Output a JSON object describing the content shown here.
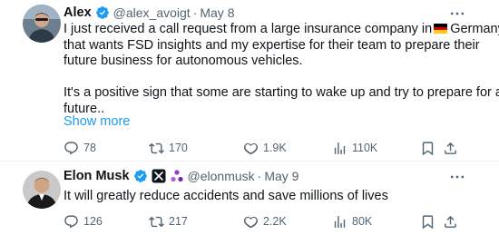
{
  "tweets": [
    {
      "name": "Alex",
      "handle": "@alex_avoigt",
      "separator": "·",
      "date": "May 8",
      "text_line1_before_flag": "I just received a call request from a large insurance company in",
      "text_line1_after_flag": "Germany",
      "text_line2": "that wants FSD insights and my expertise for their team to prepare their",
      "text_line3": "future business for autonomous vehicles.",
      "text_line4": "It's a positive sign that some are starting to wake up and try to prepare for a",
      "text_line5": "future..",
      "show_more": "Show more",
      "metrics": {
        "replies": "78",
        "reposts": "170",
        "likes": "1.9K",
        "views": "110K"
      }
    },
    {
      "name": "Elon Musk",
      "handle": "@elonmusk",
      "separator": "·",
      "date": "May 9",
      "text": "It will greatly reduce accidents and save millions of lives",
      "metrics": {
        "replies": "126",
        "reposts": "217",
        "likes": "2.2K",
        "views": "80K"
      }
    }
  ],
  "colors": {
    "verified_blue": "#1d9bf0",
    "link_blue": "#1d9bf0",
    "secondary_text": "#536471",
    "primary_text": "#0f1419",
    "flag_black": "#000000",
    "flag_red": "#dd0000",
    "flag_gold": "#ffce00"
  },
  "icons": {
    "verified": "verified-badge-icon",
    "x_affiliate": "x-logo-icon",
    "org_affiliate": "affiliate-org-icon",
    "flag": "germany-flag-icon",
    "more": "more-dots-icon",
    "reply": "reply-icon",
    "repost": "repost-icon",
    "like": "like-heart-icon",
    "views": "views-chart-icon",
    "bookmark": "bookmark-icon",
    "share": "share-icon"
  }
}
